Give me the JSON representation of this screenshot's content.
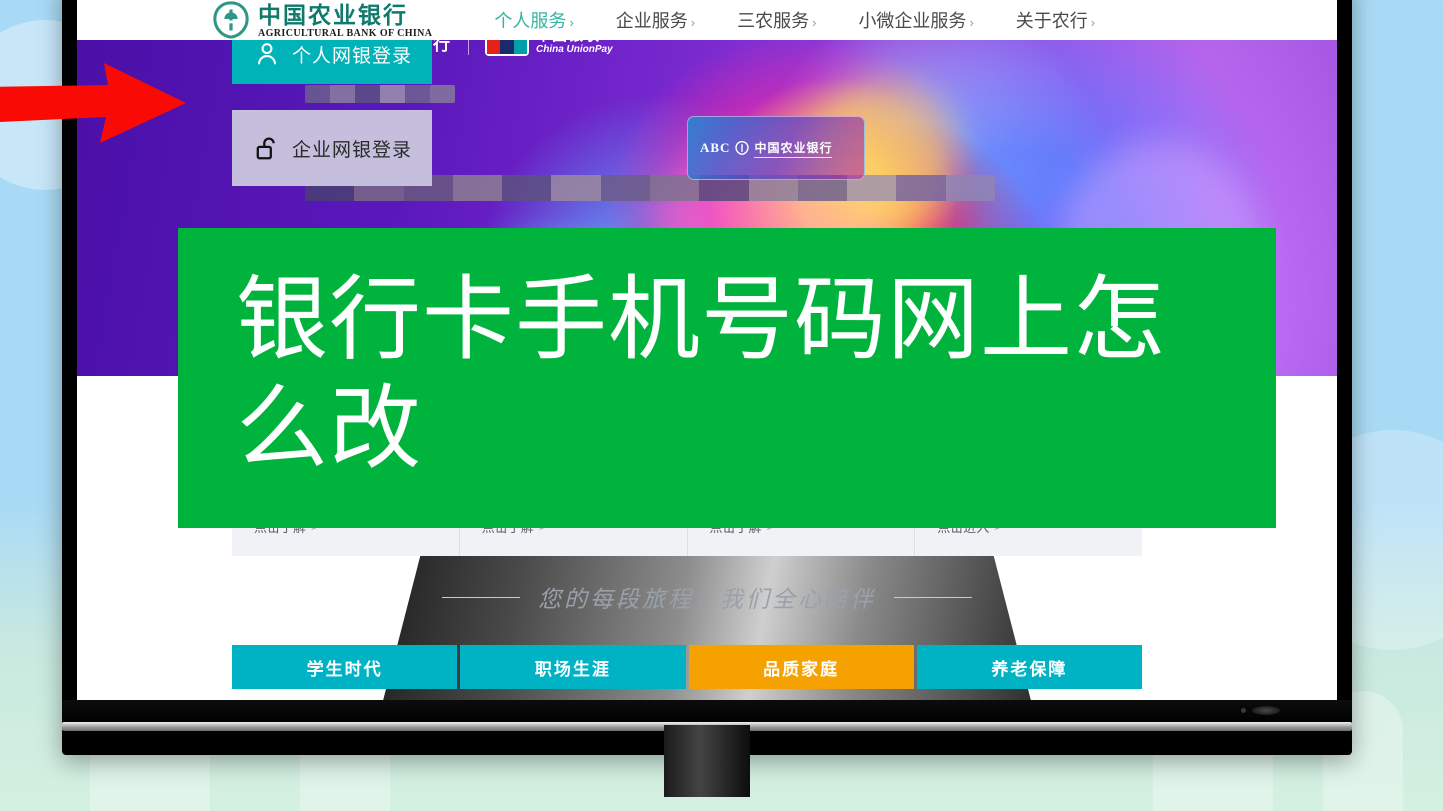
{
  "site": {
    "brand": {
      "logo_icon": "abc-wheat-shield-icon",
      "name_cn": "中国农业银行",
      "name_en": "AGRICULTURAL BANK OF CHINA"
    },
    "nav": [
      {
        "label": "个人服务",
        "chevron": "›",
        "active": true
      },
      {
        "label": "企业服务",
        "chevron": "›",
        "active": false
      },
      {
        "label": "三农服务",
        "chevron": "›",
        "active": false
      },
      {
        "label": "小微企业服务",
        "chevron": "›",
        "active": false
      },
      {
        "label": "关于农行",
        "chevron": "›",
        "active": false
      }
    ]
  },
  "login": {
    "personal": {
      "label": "个人网银登录",
      "icon": "person-icon"
    },
    "enterprise": {
      "label": "企业网银登录",
      "icon": "open-lock-icon"
    }
  },
  "hero": {
    "abc_logo": {
      "mark": "abc-wheat-shield-icon",
      "name_cn": "中国农业银行"
    },
    "unionpay": {
      "badge": "unionpay-icon",
      "name_cn": "中国银联",
      "name_en": "China UnionPay"
    },
    "card": {
      "abc": "ABC",
      "mark": "abc-wheat-shield-icon",
      "name_cn": "中国农业银行"
    }
  },
  "quick_links": [
    {
      "label": "点击了解",
      "chevron": ">"
    },
    {
      "label": "点击了解",
      "chevron": ">"
    },
    {
      "label": "点击了解",
      "chevron": ">"
    },
    {
      "label": "点击进入",
      "chevron": ">"
    }
  ],
  "tagline": "您的每段旅程，我们全心陪伴",
  "tabs": [
    {
      "label": "学生时代",
      "active": false
    },
    {
      "label": "职场生涯",
      "active": false
    },
    {
      "label": "品质家庭",
      "active": true
    },
    {
      "label": "养老保障",
      "active": false
    }
  ],
  "overlay": {
    "caption": "银行卡手机号码网上怎么改",
    "background_color": "#00b33c",
    "text_color": "#ffffff"
  },
  "annotation": {
    "arrow_icon": "red-right-arrow-icon",
    "arrow_color": "#fa0a05",
    "points_at": "个人网银登录"
  },
  "colors": {
    "teal": "#00b3b8",
    "purple": "#5a18bb",
    "green": "#00b33c",
    "orange": "#f5a201",
    "tab_teal": "#00b3c4"
  }
}
